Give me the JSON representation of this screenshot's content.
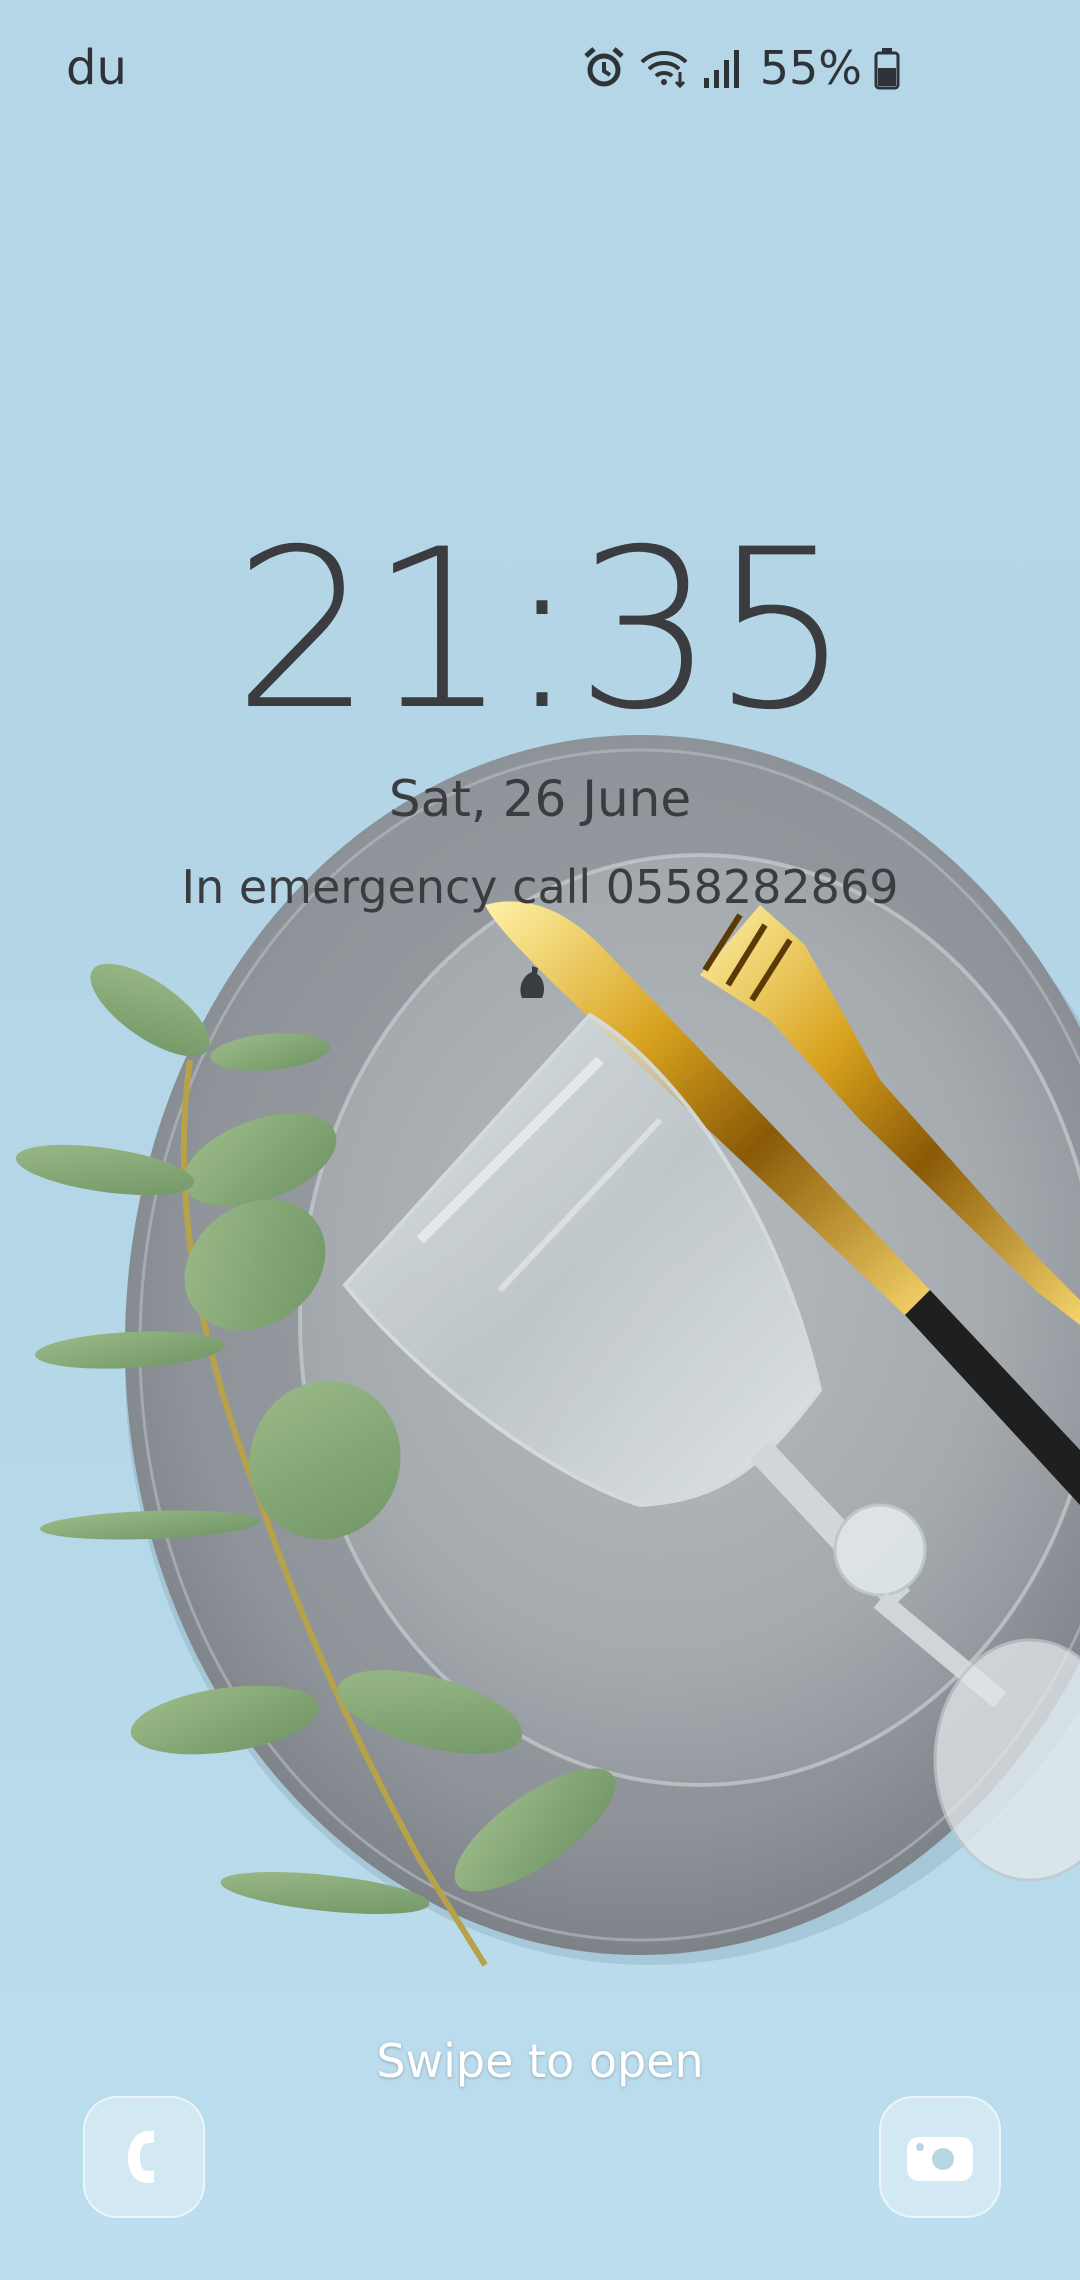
{
  "status_bar": {
    "carrier": "du",
    "battery_percent": "55%",
    "icons": [
      "alarm-icon",
      "wifi-icon",
      "signal-icon",
      "battery-icon"
    ]
  },
  "lockscreen": {
    "time": "21:35",
    "date": "Sat, 26 June",
    "owner_info": "In emergency call 0558282869",
    "swipe_hint": "Swipe to open"
  },
  "shortcuts": {
    "left": "phone-icon",
    "right": "camera-icon"
  },
  "colors": {
    "background": "#b5d6e6",
    "text": "#3a3c3f",
    "hint": "#ffffff"
  }
}
